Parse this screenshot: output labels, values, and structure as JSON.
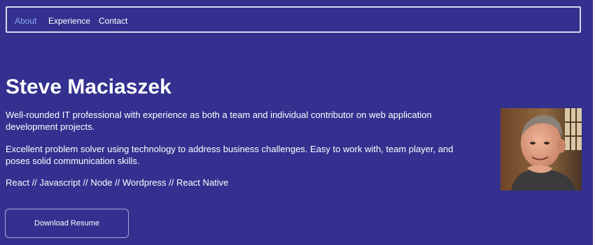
{
  "nav": {
    "items": [
      {
        "label": "About",
        "active": true
      },
      {
        "label": "Experience",
        "active": false
      },
      {
        "label": "Contact",
        "active": false
      }
    ]
  },
  "hero": {
    "name": "Steve Maciaszek",
    "paragraphs": [
      "Well-rounded IT professional with experience as both a team and individual contributor on web application development projects.",
      "Excellent problem solver using technology to address business challenges. Easy to work with, team player, and poses solid communication skills.",
      "React // Javascript // Node // Wordpress // React Native"
    ],
    "resume_button": "Download Resume"
  },
  "colors": {
    "background": "#33308f",
    "text": "#ffffff",
    "active_link": "#8da6f2",
    "border": "#d9d9ee"
  }
}
